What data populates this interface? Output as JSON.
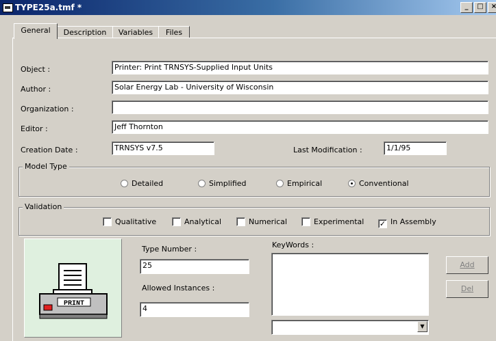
{
  "window": {
    "title": "TYPE25a.tmf *"
  },
  "title_buttons": {
    "minimize": "_",
    "maximize": "□",
    "close": "×"
  },
  "tabs": [
    {
      "label": "General",
      "active": true
    },
    {
      "label": "Description",
      "active": false
    },
    {
      "label": "Variables",
      "active": false
    },
    {
      "label": "Files",
      "active": false
    }
  ],
  "general": {
    "object_label": "Object :",
    "object_value": "Printer: Print TRNSYS-Supplied Input Units",
    "author_label": "Author :",
    "author_value": "Solar Energy Lab - University of Wisconsin",
    "organization_label": "Organization :",
    "organization_value": "",
    "editor_label": "Editor :",
    "editor_value": "Jeff Thornton",
    "creation_date_label": "Creation Date :",
    "creation_date_value": "TRNSYS v7.5",
    "last_modification_label": "Last Modification :",
    "last_modification_value": "1/1/95"
  },
  "model_type": {
    "title": "Model Type",
    "options": [
      "Detailed",
      "Simplified",
      "Empirical",
      "Conventional"
    ],
    "selected": "Conventional"
  },
  "validation": {
    "title": "Validation",
    "options": [
      {
        "label": "Qualitative",
        "checked": false
      },
      {
        "label": "Analytical",
        "checked": false
      },
      {
        "label": "Numerical",
        "checked": false
      },
      {
        "label": "Experimental",
        "checked": false
      },
      {
        "label": "In Assembly",
        "checked": true
      }
    ]
  },
  "picture": {
    "icon": "printer-icon",
    "label": "PRINT"
  },
  "type_number": {
    "label": "Type Number :",
    "value": "25"
  },
  "allowed_instances": {
    "label": "Allowed Instances :",
    "value": "4"
  },
  "keywords": {
    "label": "KeyWords :",
    "value": ""
  },
  "buttons": {
    "add": "Add",
    "del": "Del"
  }
}
